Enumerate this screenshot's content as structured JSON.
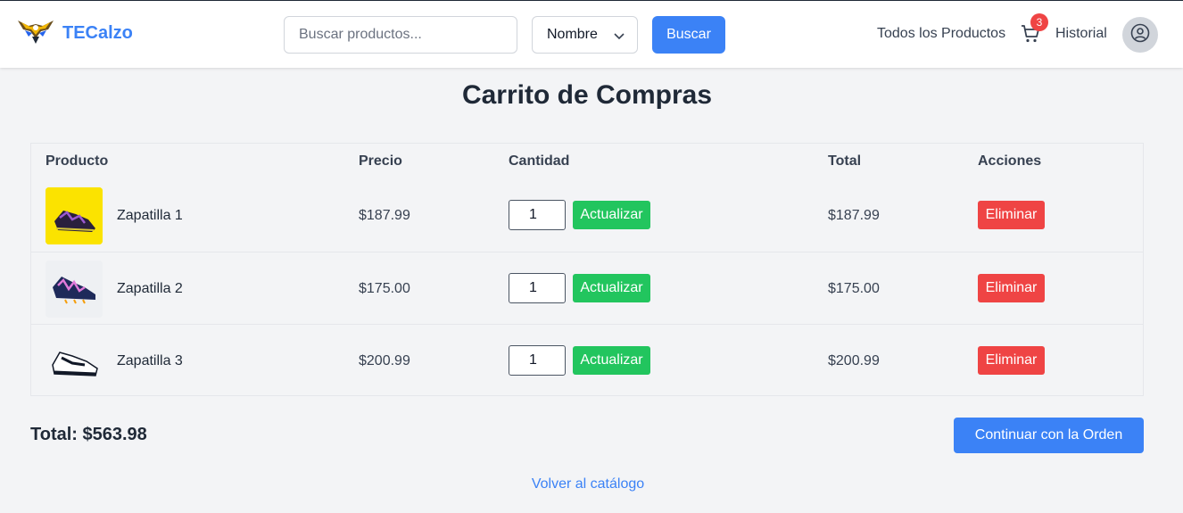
{
  "header": {
    "brand": "TECalzo",
    "search_placeholder": "Buscar productos...",
    "sort_value": "Nombre",
    "search_button": "Buscar",
    "nav_all_products": "Todos los Productos",
    "cart_count": "3",
    "nav_history": "Historial"
  },
  "page": {
    "title": "Carrito de Compras"
  },
  "table": {
    "columns": [
      "Producto",
      "Precio",
      "Cantidad",
      "Total",
      "Acciones"
    ],
    "rows": [
      {
        "name": "Zapatilla 1",
        "price": "$187.99",
        "quantity": "1",
        "total": "$187.99",
        "update_label": "Actualizar",
        "delete_label": "Eliminar"
      },
      {
        "name": "Zapatilla 2",
        "price": "$175.00",
        "quantity": "1",
        "total": "$175.00",
        "update_label": "Actualizar",
        "delete_label": "Eliminar"
      },
      {
        "name": "Zapatilla 3",
        "price": "$200.99",
        "quantity": "1",
        "total": "$200.99",
        "update_label": "Actualizar",
        "delete_label": "Eliminar"
      }
    ]
  },
  "summary": {
    "total_label": "Total: $563.98",
    "continue_button": "Continuar con la Orden",
    "back_link": "Volver al catálogo"
  },
  "colors": {
    "primary": "#3b82f6",
    "success": "#22c55e",
    "danger": "#ef4444",
    "background": "#f3f4f6"
  },
  "icons": {
    "logo": "eagle-logo",
    "cart": "cart-icon",
    "avatar": "user-circle-icon",
    "sort": "chevron-down-icon"
  }
}
